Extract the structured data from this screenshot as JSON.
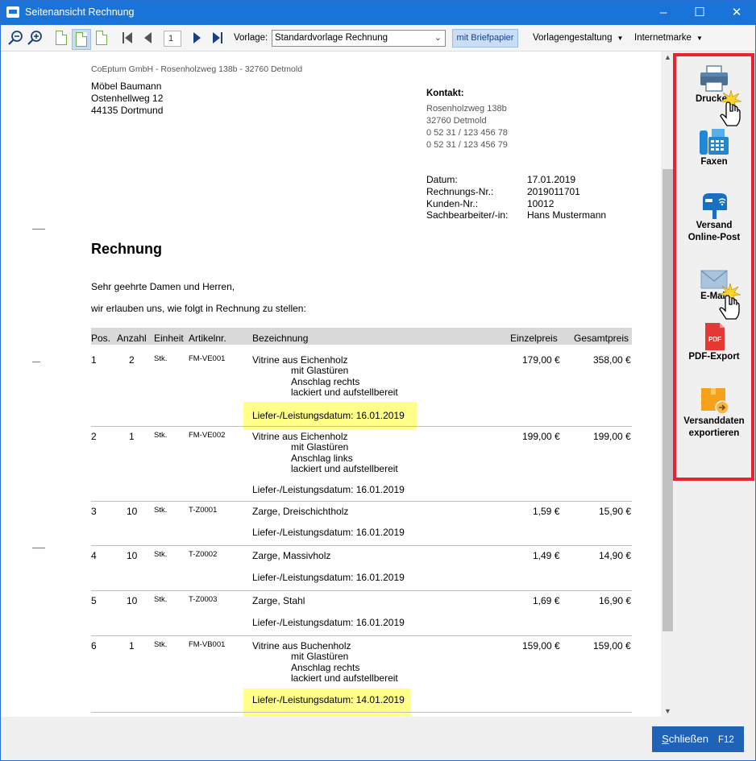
{
  "window": {
    "title": "Seitenansicht Rechnung",
    "minimize": "–",
    "maximize": "☐",
    "close": "✕"
  },
  "toolbar": {
    "page_number": "1",
    "vorlage_label": "Vorlage:",
    "vorlage_value": "Standardvorlage Rechnung",
    "briefpapier": "mit Briefpapier",
    "vorlagengestaltung": "Vorlagengestaltung",
    "internetmarke": "Internetmarke"
  },
  "document": {
    "sender_line": "CoEptum GmbH - Rosenholzweg 138b - 32760 Detmold",
    "recipient": [
      "Möbel Baumann",
      "Ostenhellweg 12",
      "44135 Dortmund"
    ],
    "contact_title": "Kontakt:",
    "contact_lines": [
      "Rosenholzweg 138b",
      "32760 Detmold",
      "0 52 31 / 123 456 78",
      "0 52 31 / 123 456 79"
    ],
    "meta": [
      {
        "label": "Datum:",
        "value": "17.01.2019"
      },
      {
        "label": "Rechnungs-Nr.:",
        "value": "2019011701"
      },
      {
        "label": "Kunden-Nr.:",
        "value": "10012"
      },
      {
        "label": "Sachbearbeiter/-in:",
        "value": "Hans Mustermann"
      }
    ],
    "title": "Rechnung",
    "salutation": "Sehr geehrte Damen und Herren,",
    "intro": "wir erlauben uns, wie folgt in Rechnung zu stellen:",
    "columns": [
      "Pos.",
      "Anzahl",
      "Einheit",
      "Artikelnr.",
      "Bezeichnung",
      "Einzelpreis",
      "Gesamtpreis"
    ],
    "rows": [
      {
        "pos": "1",
        "anzahl": "2",
        "einheit": "Stk.",
        "artikel": "FM-VE001",
        "bezeichnung": "Vitrine aus Eichenholz",
        "details": [
          "mit Glastüren",
          "Anschlag rechts",
          "lackiert und aufstellbereit"
        ],
        "einzel": "179,00 €",
        "gesamt": "358,00 €",
        "liefer": "Liefer-/Leistungsdatum: 16.01.2019"
      },
      {
        "pos": "2",
        "anzahl": "1",
        "einheit": "Stk.",
        "artikel": "FM-VE002",
        "bezeichnung": "Vitrine aus Eichenholz",
        "details": [
          "mit Glastüren",
          "Anschlag links",
          "lackiert und aufstellbereit"
        ],
        "einzel": "199,00 €",
        "gesamt": "199,00 €",
        "liefer": "Liefer-/Leistungsdatum: 16.01.2019"
      },
      {
        "pos": "3",
        "anzahl": "10",
        "einheit": "Stk.",
        "artikel": "T-Z0001",
        "bezeichnung": "Zarge, Dreischichtholz",
        "details": [],
        "einzel": "1,59 €",
        "gesamt": "15,90 €",
        "liefer": "Liefer-/Leistungsdatum: 16.01.2019"
      },
      {
        "pos": "4",
        "anzahl": "10",
        "einheit": "Stk.",
        "artikel": "T-Z0002",
        "bezeichnung": "Zarge, Massivholz",
        "details": [],
        "einzel": "1,49 €",
        "gesamt": "14,90 €",
        "liefer": "Liefer-/Leistungsdatum: 16.01.2019"
      },
      {
        "pos": "5",
        "anzahl": "10",
        "einheit": "Stk.",
        "artikel": "T-Z0003",
        "bezeichnung": "Zarge, Stahl",
        "details": [],
        "einzel": "1,69 €",
        "gesamt": "16,90 €",
        "liefer": "Liefer-/Leistungsdatum: 16.01.2019"
      },
      {
        "pos": "6",
        "anzahl": "1",
        "einheit": "Stk.",
        "artikel": "FM-VB001",
        "bezeichnung": "Vitrine aus Buchenholz",
        "details": [
          "mit Glastüren",
          "Anschlag rechts",
          "lackiert und aufstellbereit"
        ],
        "einzel": "159,00 €",
        "gesamt": "159,00 €",
        "liefer": "Liefer-/Leistungsdatum: 14.01.2019"
      }
    ]
  },
  "actions": {
    "drucken": "Drucken",
    "faxen": "Faxen",
    "versand_line1": "Versand",
    "versand_line2": "Online-Post",
    "email": "E-Mail",
    "pdf": "PDF-Export",
    "pdf_icon_text": "PDF",
    "versanddaten_line1": "Versanddaten",
    "versanddaten_line2": "exportieren"
  },
  "footer": {
    "close_label_underlined": "S",
    "close_label_rest": "chließen",
    "close_shortcut": "F12"
  },
  "colors": {
    "titlebar": "#1a73d8",
    "highlight": "#ffff8a",
    "frame": "#e8252f",
    "close_button": "#1f63b8"
  }
}
